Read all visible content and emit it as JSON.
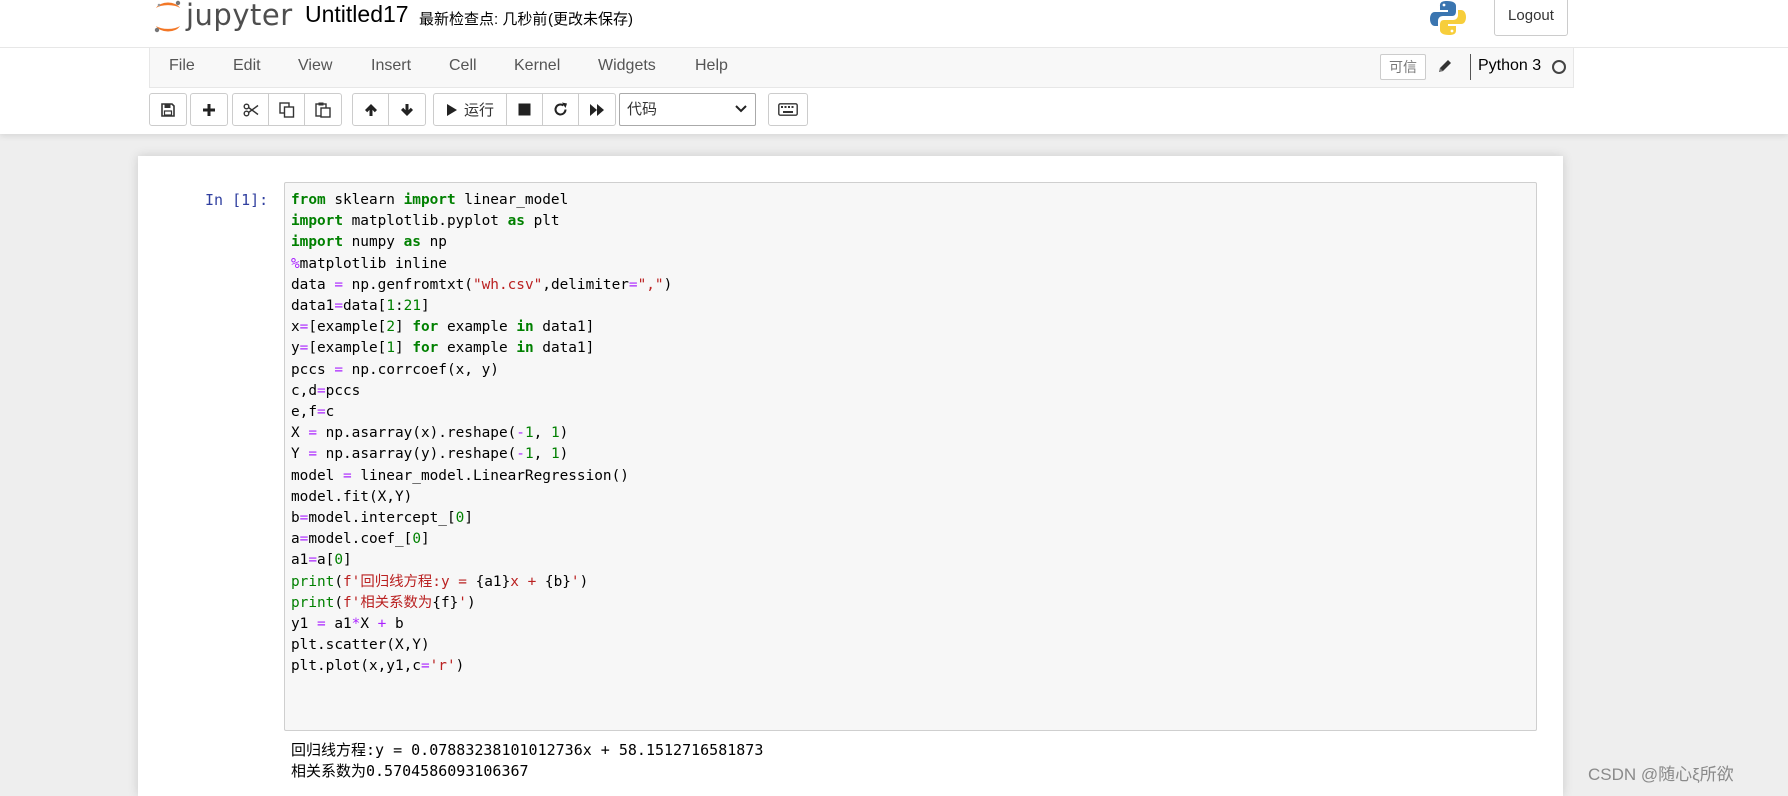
{
  "header": {
    "logo_text": "jupyter",
    "notebook_name": "Untitled17",
    "checkpoint": "最新检查点: 几秒前",
    "autosave_status": "(更改未保存)",
    "logout_label": "Logout"
  },
  "menubar": {
    "items": [
      "File",
      "Edit",
      "View",
      "Insert",
      "Cell",
      "Kernel",
      "Widgets",
      "Help"
    ],
    "trusted_label": "可信",
    "kernel_name": "Python 3"
  },
  "toolbar": {
    "run_label": "运行",
    "cell_type": "代码"
  },
  "cell": {
    "prompt": "In  [1]:",
    "output_lines": [
      "回归线方程:y = 0.07883238101012736x + 58.1512716581873",
      "相关系数为0.5704586093106367"
    ]
  },
  "watermark": "CSDN @随心ξ所欲",
  "colors": {
    "keyword": "#008000",
    "operator": "#aa22ff",
    "string": "#ba2121",
    "prompt_in": "#303f9f"
  },
  "icons": {
    "save": "floppy-disk-icon",
    "add": "plus-icon",
    "cut": "scissors-icon",
    "copy": "copy-icon",
    "paste": "paste-icon",
    "move_up": "arrow-up-icon",
    "move_down": "arrow-down-icon",
    "run": "play-icon",
    "interrupt": "stop-icon",
    "restart": "refresh-icon",
    "restart_run_all": "fast-forward-icon",
    "command_palette": "keyboard-icon"
  }
}
